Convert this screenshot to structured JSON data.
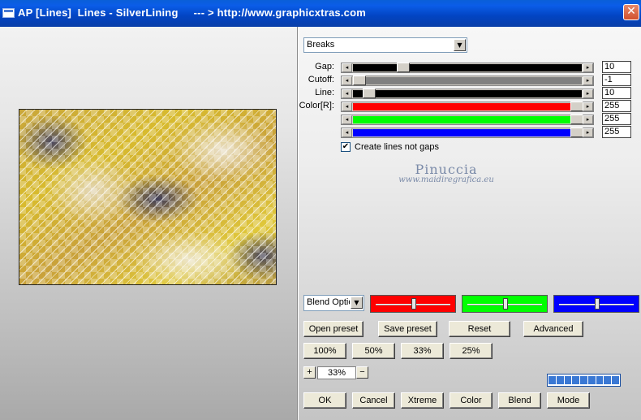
{
  "window": {
    "title": "AP [Lines]  Lines - SilverLining     --- > http://www.graphicxtras.com",
    "close_glyph": "✕"
  },
  "mode_dropdown": {
    "value": "Breaks",
    "arrow": "▼"
  },
  "params": [
    {
      "label": "Gap:",
      "value": "10",
      "level": 0.2,
      "track_color": "#000000"
    },
    {
      "label": "Cutoff:",
      "value": "-1",
      "level": 0.0,
      "track_color": "#808080"
    },
    {
      "label": "Line:",
      "value": "10",
      "level": 0.0,
      "track_color": "#000000"
    },
    {
      "label": "Color[R]:",
      "value": "255",
      "level": 1.0,
      "track_color": "#ff0000"
    },
    {
      "label": "",
      "value": "255",
      "level": 1.0,
      "track_color": "#00ff00"
    },
    {
      "label": "",
      "value": "255",
      "level": 1.0,
      "track_color": "#0000ff"
    }
  ],
  "slider_arrows": {
    "left": "◂",
    "right": "▸"
  },
  "checkbox": {
    "label": "Create lines not gaps",
    "checked": true,
    "mark": "✔"
  },
  "watermark": {
    "line1": "Pinuccia",
    "line2": "www.maidiregrafica.eu"
  },
  "blend_dropdown": {
    "value": "Blend Optio",
    "arrow": "▼"
  },
  "color_sliders": [
    {
      "color": "#ff0000",
      "level": 0.5
    },
    {
      "color": "#00ff00",
      "level": 0.5
    },
    {
      "color": "#0000ff",
      "level": 0.5
    }
  ],
  "preset_buttons": {
    "open": "Open preset",
    "save": "Save preset",
    "reset": "Reset",
    "advanced": "Advanced"
  },
  "zoom_buttons": [
    "100%",
    "50%",
    "33%",
    "25%"
  ],
  "zoom": {
    "plus": "+",
    "value": "33%",
    "minus": "−"
  },
  "progress_segments": 9,
  "bottom_buttons": {
    "ok": "OK",
    "cancel": "Cancel",
    "xtreme": "Xtreme",
    "color": "Color",
    "blend": "Blend",
    "mode": "Mode"
  }
}
